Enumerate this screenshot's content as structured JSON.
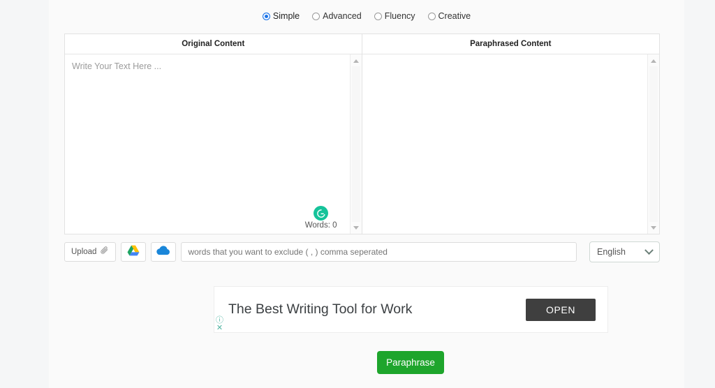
{
  "modes": [
    {
      "label": "Simple",
      "selected": true,
      "icon": "radio-selected-icon"
    },
    {
      "label": "Advanced",
      "selected": false,
      "icon": "radio-icon"
    },
    {
      "label": "Fluency",
      "selected": false,
      "icon": "radio-icon"
    },
    {
      "label": "Creative",
      "selected": false,
      "icon": "radio-icon"
    }
  ],
  "panels": {
    "original": {
      "title": "Original Content",
      "placeholder": "Write Your Text Here ...",
      "word_count_label": "Words: 0",
      "badge_icon": "grammarly-icon",
      "scroll_up_icon": "scroll-up-arrow-icon",
      "scroll_down_icon": "scroll-down-arrow-icon"
    },
    "paraphrased": {
      "title": "Paraphrased Content",
      "content": "",
      "scroll_up_icon": "scroll-up-arrow-icon",
      "scroll_down_icon": "scroll-down-arrow-icon"
    }
  },
  "toolbar": {
    "upload_label": "Upload",
    "upload_icon": "paperclip-icon",
    "google_drive_icon": "google-drive-icon",
    "onedrive_icon": "cloud-icon",
    "exclude_placeholder": "words that you want to exclude ( , ) comma seperated",
    "exclude_value": "",
    "language_value": "English",
    "language_chevron_icon": "chevron-down-icon"
  },
  "ad": {
    "headline": "The Best Writing Tool for Work",
    "cta_label": "OPEN",
    "info_icon": "ad-info-icon",
    "info_glyph": "ⓘ",
    "close_icon": "ad-close-icon",
    "close_glyph": "✕"
  },
  "actions": {
    "paraphrase_label": "Paraphrase"
  },
  "colors": {
    "accent_green": "#1ea52c",
    "radio_blue": "#1a73e8",
    "grammarly_green": "#15c39a",
    "ad_button_dark": "#3f3f3f",
    "page_bg": "#fafafa"
  }
}
